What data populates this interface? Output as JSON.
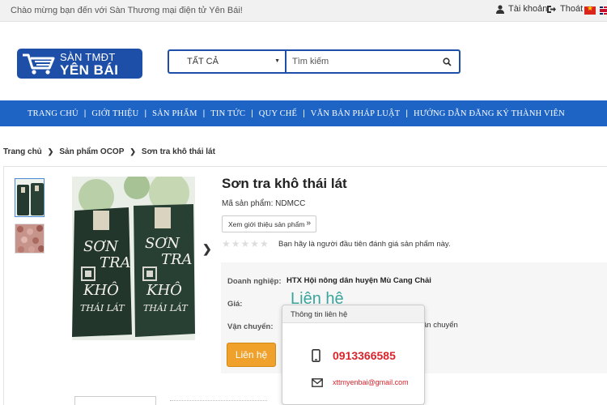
{
  "topbar": {
    "welcome": "Chào mừng bạn đến với Sàn Thương mại điện tử Yên Bái!",
    "account": "Tài khoản",
    "logout": "Thoát"
  },
  "logo": {
    "line1": "SÀN TMĐT",
    "line2": "YÊN BÁI"
  },
  "search": {
    "category": "TẤT CẢ",
    "placeholder": "Tìm kiếm"
  },
  "nav": {
    "items": [
      "TRANG CHỦ",
      "GIỚI THIỆU",
      "SẢN PHẨM",
      "TIN TỨC",
      "QUY CHẾ",
      "VĂN BẢN PHÁP LUẬT",
      "HƯỚNG DẪN ĐĂNG KÝ THÀNH VIÊN"
    ]
  },
  "breadcrumb": {
    "items": [
      "Trang chủ",
      "Sản phẩm OCOP",
      "Sơn tra khô thái lát"
    ]
  },
  "product": {
    "title": "Sơn tra khô thái lát",
    "code": "Mã sản phẩm: NDMCC",
    "intro_button": "Xem giới thiệu sản phẩm",
    "rating_text": "Bạn hãy là người đầu tiên đánh giá sản phẩm này.",
    "rating_stars": 0,
    "labels": {
      "business": "Doanh nghiệp:",
      "price": "Giá:",
      "shipping": "Vận chuyển:"
    },
    "business": "HTX Hội nông dân huyện Mù Cang Chải",
    "price": "Liên hệ",
    "shipping_tail": "ận chuyển",
    "contact_button": "Liên hệ",
    "image_text": [
      "SƠN",
      "TRA",
      "KHÔ",
      "THÁI LÁT"
    ]
  },
  "contact_popup": {
    "title": "Thông tin liên hệ",
    "phone": "0913366585",
    "email": "xttmyenbai@gmail.com"
  },
  "colors": {
    "nav_bg": "#1d64c5",
    "logo_bg": "#1e4fa8",
    "price": "#3aa59c",
    "contact_btn": "#f0a12b",
    "popup_text": "#d9242c"
  }
}
